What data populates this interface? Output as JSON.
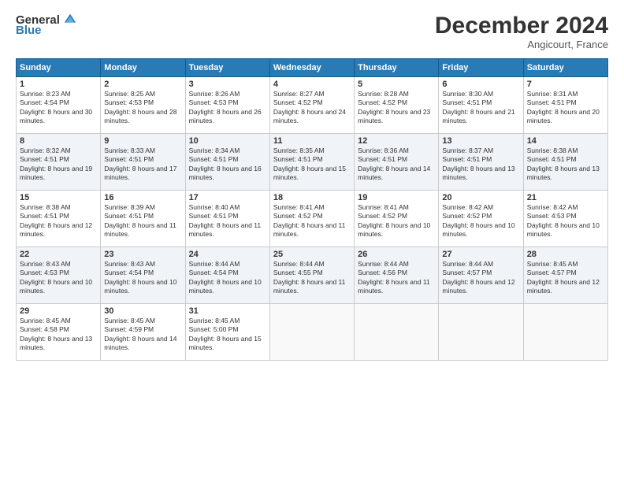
{
  "logo": {
    "general": "General",
    "blue": "Blue"
  },
  "header": {
    "month": "December 2024",
    "location": "Angicourt, France"
  },
  "weekdays": [
    "Sunday",
    "Monday",
    "Tuesday",
    "Wednesday",
    "Thursday",
    "Friday",
    "Saturday"
  ],
  "weeks": [
    [
      {
        "day": "1",
        "rise": "8:23 AM",
        "set": "4:54 PM",
        "daylight": "8 hours and 30 minutes"
      },
      {
        "day": "2",
        "rise": "8:25 AM",
        "set": "4:53 PM",
        "daylight": "8 hours and 28 minutes"
      },
      {
        "day": "3",
        "rise": "8:26 AM",
        "set": "4:53 PM",
        "daylight": "8 hours and 26 minutes"
      },
      {
        "day": "4",
        "rise": "8:27 AM",
        "set": "4:52 PM",
        "daylight": "8 hours and 24 minutes"
      },
      {
        "day": "5",
        "rise": "8:28 AM",
        "set": "4:52 PM",
        "daylight": "8 hours and 23 minutes"
      },
      {
        "day": "6",
        "rise": "8:30 AM",
        "set": "4:51 PM",
        "daylight": "8 hours and 21 minutes"
      },
      {
        "day": "7",
        "rise": "8:31 AM",
        "set": "4:51 PM",
        "daylight": "8 hours and 20 minutes"
      }
    ],
    [
      {
        "day": "8",
        "rise": "8:32 AM",
        "set": "4:51 PM",
        "daylight": "8 hours and 19 minutes"
      },
      {
        "day": "9",
        "rise": "8:33 AM",
        "set": "4:51 PM",
        "daylight": "8 hours and 17 minutes"
      },
      {
        "day": "10",
        "rise": "8:34 AM",
        "set": "4:51 PM",
        "daylight": "8 hours and 16 minutes"
      },
      {
        "day": "11",
        "rise": "8:35 AM",
        "set": "4:51 PM",
        "daylight": "8 hours and 15 minutes"
      },
      {
        "day": "12",
        "rise": "8:36 AM",
        "set": "4:51 PM",
        "daylight": "8 hours and 14 minutes"
      },
      {
        "day": "13",
        "rise": "8:37 AM",
        "set": "4:51 PM",
        "daylight": "8 hours and 13 minutes"
      },
      {
        "day": "14",
        "rise": "8:38 AM",
        "set": "4:51 PM",
        "daylight": "8 hours and 13 minutes"
      }
    ],
    [
      {
        "day": "15",
        "rise": "8:38 AM",
        "set": "4:51 PM",
        "daylight": "8 hours and 12 minutes"
      },
      {
        "day": "16",
        "rise": "8:39 AM",
        "set": "4:51 PM",
        "daylight": "8 hours and 11 minutes"
      },
      {
        "day": "17",
        "rise": "8:40 AM",
        "set": "4:51 PM",
        "daylight": "8 hours and 11 minutes"
      },
      {
        "day": "18",
        "rise": "8:41 AM",
        "set": "4:52 PM",
        "daylight": "8 hours and 11 minutes"
      },
      {
        "day": "19",
        "rise": "8:41 AM",
        "set": "4:52 PM",
        "daylight": "8 hours and 10 minutes"
      },
      {
        "day": "20",
        "rise": "8:42 AM",
        "set": "4:52 PM",
        "daylight": "8 hours and 10 minutes"
      },
      {
        "day": "21",
        "rise": "8:42 AM",
        "set": "4:53 PM",
        "daylight": "8 hours and 10 minutes"
      }
    ],
    [
      {
        "day": "22",
        "rise": "8:43 AM",
        "set": "4:53 PM",
        "daylight": "8 hours and 10 minutes"
      },
      {
        "day": "23",
        "rise": "8:43 AM",
        "set": "4:54 PM",
        "daylight": "8 hours and 10 minutes"
      },
      {
        "day": "24",
        "rise": "8:44 AM",
        "set": "4:54 PM",
        "daylight": "8 hours and 10 minutes"
      },
      {
        "day": "25",
        "rise": "8:44 AM",
        "set": "4:55 PM",
        "daylight": "8 hours and 11 minutes"
      },
      {
        "day": "26",
        "rise": "8:44 AM",
        "set": "4:56 PM",
        "daylight": "8 hours and 11 minutes"
      },
      {
        "day": "27",
        "rise": "8:44 AM",
        "set": "4:57 PM",
        "daylight": "8 hours and 12 minutes"
      },
      {
        "day": "28",
        "rise": "8:45 AM",
        "set": "4:57 PM",
        "daylight": "8 hours and 12 minutes"
      }
    ],
    [
      {
        "day": "29",
        "rise": "8:45 AM",
        "set": "4:58 PM",
        "daylight": "8 hours and 13 minutes"
      },
      {
        "day": "30",
        "rise": "8:45 AM",
        "set": "4:59 PM",
        "daylight": "8 hours and 14 minutes"
      },
      {
        "day": "31",
        "rise": "8:45 AM",
        "set": "5:00 PM",
        "daylight": "8 hours and 15 minutes"
      },
      null,
      null,
      null,
      null
    ]
  ],
  "labels": {
    "sunrise": "Sunrise:",
    "sunset": "Sunset:",
    "daylight": "Daylight:"
  }
}
